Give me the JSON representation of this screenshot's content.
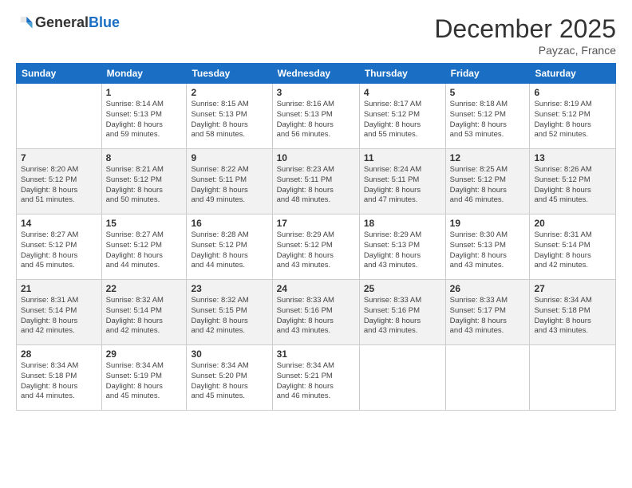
{
  "header": {
    "logo_line1": "General",
    "logo_line2": "Blue",
    "month": "December 2025",
    "location": "Payzac, France"
  },
  "weekdays": [
    "Sunday",
    "Monday",
    "Tuesday",
    "Wednesday",
    "Thursday",
    "Friday",
    "Saturday"
  ],
  "weeks": [
    [
      {
        "day": "",
        "info": ""
      },
      {
        "day": "1",
        "info": "Sunrise: 8:14 AM\nSunset: 5:13 PM\nDaylight: 8 hours\nand 59 minutes."
      },
      {
        "day": "2",
        "info": "Sunrise: 8:15 AM\nSunset: 5:13 PM\nDaylight: 8 hours\nand 58 minutes."
      },
      {
        "day": "3",
        "info": "Sunrise: 8:16 AM\nSunset: 5:13 PM\nDaylight: 8 hours\nand 56 minutes."
      },
      {
        "day": "4",
        "info": "Sunrise: 8:17 AM\nSunset: 5:12 PM\nDaylight: 8 hours\nand 55 minutes."
      },
      {
        "day": "5",
        "info": "Sunrise: 8:18 AM\nSunset: 5:12 PM\nDaylight: 8 hours\nand 53 minutes."
      },
      {
        "day": "6",
        "info": "Sunrise: 8:19 AM\nSunset: 5:12 PM\nDaylight: 8 hours\nand 52 minutes."
      }
    ],
    [
      {
        "day": "7",
        "info": "Sunrise: 8:20 AM\nSunset: 5:12 PM\nDaylight: 8 hours\nand 51 minutes."
      },
      {
        "day": "8",
        "info": "Sunrise: 8:21 AM\nSunset: 5:12 PM\nDaylight: 8 hours\nand 50 minutes."
      },
      {
        "day": "9",
        "info": "Sunrise: 8:22 AM\nSunset: 5:11 PM\nDaylight: 8 hours\nand 49 minutes."
      },
      {
        "day": "10",
        "info": "Sunrise: 8:23 AM\nSunset: 5:11 PM\nDaylight: 8 hours\nand 48 minutes."
      },
      {
        "day": "11",
        "info": "Sunrise: 8:24 AM\nSunset: 5:11 PM\nDaylight: 8 hours\nand 47 minutes."
      },
      {
        "day": "12",
        "info": "Sunrise: 8:25 AM\nSunset: 5:12 PM\nDaylight: 8 hours\nand 46 minutes."
      },
      {
        "day": "13",
        "info": "Sunrise: 8:26 AM\nSunset: 5:12 PM\nDaylight: 8 hours\nand 45 minutes."
      }
    ],
    [
      {
        "day": "14",
        "info": "Sunrise: 8:27 AM\nSunset: 5:12 PM\nDaylight: 8 hours\nand 45 minutes."
      },
      {
        "day": "15",
        "info": "Sunrise: 8:27 AM\nSunset: 5:12 PM\nDaylight: 8 hours\nand 44 minutes."
      },
      {
        "day": "16",
        "info": "Sunrise: 8:28 AM\nSunset: 5:12 PM\nDaylight: 8 hours\nand 44 minutes."
      },
      {
        "day": "17",
        "info": "Sunrise: 8:29 AM\nSunset: 5:12 PM\nDaylight: 8 hours\nand 43 minutes."
      },
      {
        "day": "18",
        "info": "Sunrise: 8:29 AM\nSunset: 5:13 PM\nDaylight: 8 hours\nand 43 minutes."
      },
      {
        "day": "19",
        "info": "Sunrise: 8:30 AM\nSunset: 5:13 PM\nDaylight: 8 hours\nand 43 minutes."
      },
      {
        "day": "20",
        "info": "Sunrise: 8:31 AM\nSunset: 5:14 PM\nDaylight: 8 hours\nand 42 minutes."
      }
    ],
    [
      {
        "day": "21",
        "info": "Sunrise: 8:31 AM\nSunset: 5:14 PM\nDaylight: 8 hours\nand 42 minutes."
      },
      {
        "day": "22",
        "info": "Sunrise: 8:32 AM\nSunset: 5:14 PM\nDaylight: 8 hours\nand 42 minutes."
      },
      {
        "day": "23",
        "info": "Sunrise: 8:32 AM\nSunset: 5:15 PM\nDaylight: 8 hours\nand 42 minutes."
      },
      {
        "day": "24",
        "info": "Sunrise: 8:33 AM\nSunset: 5:16 PM\nDaylight: 8 hours\nand 43 minutes."
      },
      {
        "day": "25",
        "info": "Sunrise: 8:33 AM\nSunset: 5:16 PM\nDaylight: 8 hours\nand 43 minutes."
      },
      {
        "day": "26",
        "info": "Sunrise: 8:33 AM\nSunset: 5:17 PM\nDaylight: 8 hours\nand 43 minutes."
      },
      {
        "day": "27",
        "info": "Sunrise: 8:34 AM\nSunset: 5:18 PM\nDaylight: 8 hours\nand 43 minutes."
      }
    ],
    [
      {
        "day": "28",
        "info": "Sunrise: 8:34 AM\nSunset: 5:18 PM\nDaylight: 8 hours\nand 44 minutes."
      },
      {
        "day": "29",
        "info": "Sunrise: 8:34 AM\nSunset: 5:19 PM\nDaylight: 8 hours\nand 45 minutes."
      },
      {
        "day": "30",
        "info": "Sunrise: 8:34 AM\nSunset: 5:20 PM\nDaylight: 8 hours\nand 45 minutes."
      },
      {
        "day": "31",
        "info": "Sunrise: 8:34 AM\nSunset: 5:21 PM\nDaylight: 8 hours\nand 46 minutes."
      },
      {
        "day": "",
        "info": ""
      },
      {
        "day": "",
        "info": ""
      },
      {
        "day": "",
        "info": ""
      }
    ]
  ]
}
